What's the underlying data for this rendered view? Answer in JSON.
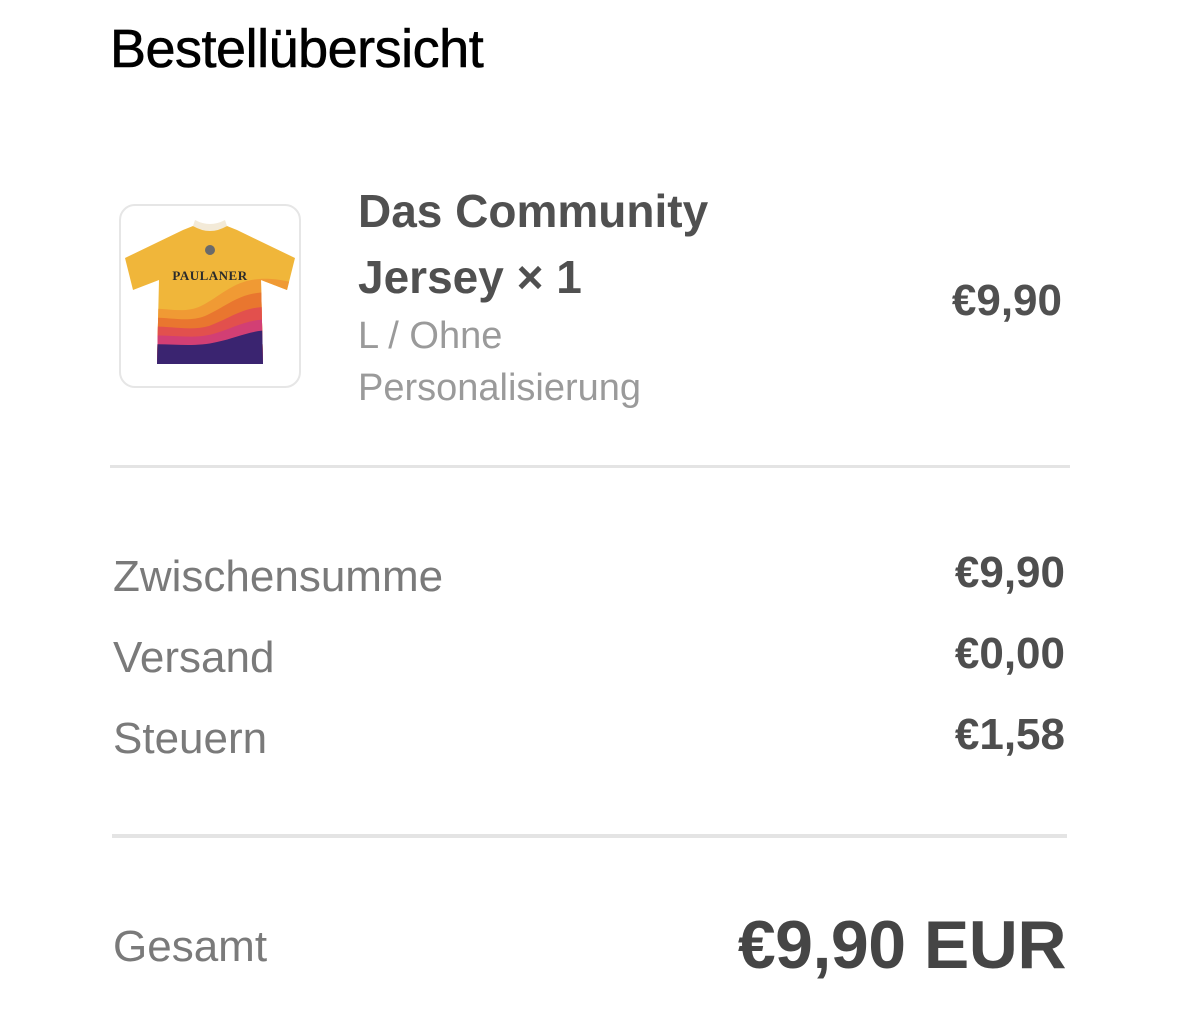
{
  "title": "Bestellübersicht",
  "item": {
    "name_line1": "Das Community",
    "name_line2": "Jersey × 1",
    "variant_line1": "L / Ohne",
    "variant_line2": "Personalisierung",
    "price": "€9,90",
    "image_text": "PAULANER"
  },
  "summary": {
    "subtotal_label": "Zwischensumme",
    "subtotal_value": "€9,90",
    "shipping_label": "Versand",
    "shipping_value": "€0,00",
    "tax_label": "Steuern",
    "tax_value": "€1,58"
  },
  "total": {
    "label": "Gesamt",
    "value": "€9,90 EUR"
  },
  "colors": {
    "jersey_yellow": "#f0b63a",
    "jersey_orange": "#e9762f",
    "jersey_pink": "#d23f74",
    "jersey_purple": "#3a2470"
  }
}
